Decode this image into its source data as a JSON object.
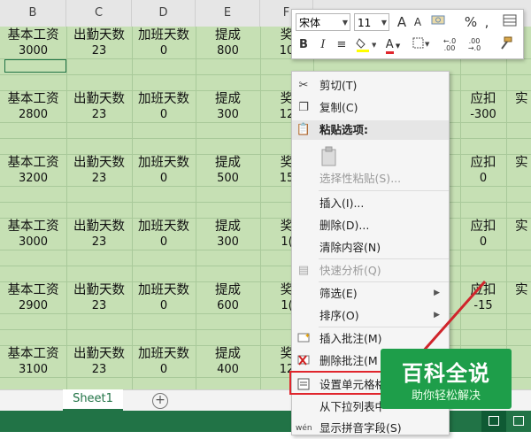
{
  "column_headers": [
    "B",
    "C",
    "D",
    "E",
    "F"
  ],
  "record_header": [
    "基本工资",
    "出勤天数",
    "加班天数",
    "提成",
    "奖"
  ],
  "records": [
    {
      "base": "3000",
      "days": "23",
      "ot": "0",
      "comm": "800",
      "bonus": "10"
    },
    {
      "base": "2800",
      "days": "23",
      "ot": "0",
      "comm": "300",
      "bonus": "12",
      "deduct": "-300"
    },
    {
      "base": "3200",
      "days": "23",
      "ot": "0",
      "comm": "500",
      "bonus": "15",
      "deduct": "0"
    },
    {
      "base": "3000",
      "days": "23",
      "ot": "0",
      "comm": "300",
      "bonus": "1(",
      "deduct": "0"
    },
    {
      "base": "2900",
      "days": "23",
      "ot": "0",
      "comm": "600",
      "bonus": "1(",
      "deduct": "-15"
    },
    {
      "base": "3100",
      "days": "23",
      "ot": "0",
      "comm": "400",
      "bonus": "12"
    }
  ],
  "right_header": {
    "deduct_label": "应扣",
    "real_label": "实"
  },
  "tabs": {
    "sheet1": "Sheet1",
    "add": "+"
  },
  "mini_toolbar": {
    "font_name": "宋体",
    "font_size": "11",
    "grow": "A",
    "shrink": "A",
    "percent": "%",
    "comma": ",",
    "bold": "B",
    "italic": "I",
    "align": "≡",
    "font_color_letter": "A",
    "dec_inc": "←.0 .00",
    "dec_dec": ".00 →.0"
  },
  "context_menu": {
    "cut": "剪切(T)",
    "copy": "复制(C)",
    "paste_options": "粘贴选项:",
    "paste_special": "选择性粘贴(S)...",
    "insert": "插入(I)...",
    "delete": "删除(D)...",
    "clear": "清除内容(N)",
    "quick_analysis": "快速分析(Q)",
    "filter": "筛选(E)",
    "sort": "排序(O)",
    "insert_comment": "插入批注(M)",
    "delete_comment": "删除批注(M",
    "format_cells": "设置单元格格",
    "pick_list": "从下拉列表中",
    "phonetic": "显示拼音字段(S)"
  },
  "watermark": {
    "title": "百科全说",
    "subtitle": "助你轻松解决"
  },
  "colors": {
    "green_band": "#c6e0b4",
    "excel_green": "#217346",
    "highlight_red": "#e0262d",
    "watermark_green": "#1e9e4a"
  }
}
